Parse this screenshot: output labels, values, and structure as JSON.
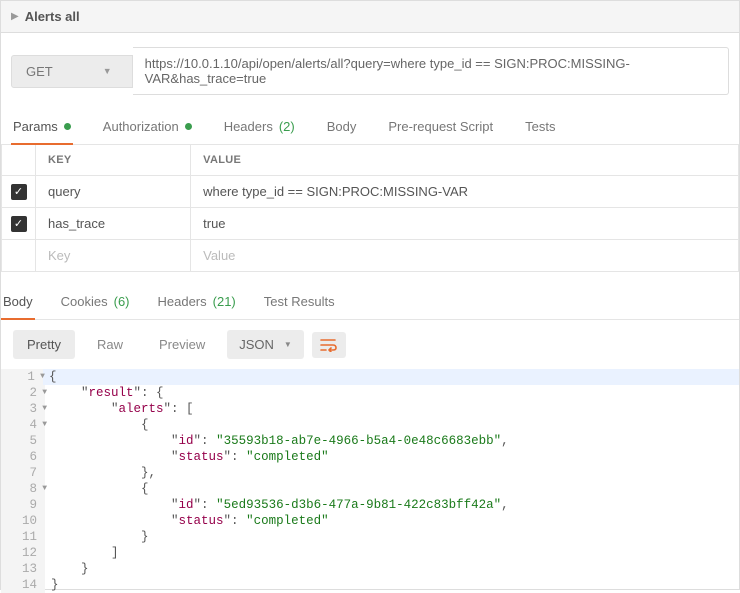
{
  "header": {
    "title": "Alerts all"
  },
  "request": {
    "method": "GET",
    "url": "https://10.0.1.10/api/open/alerts/all?query=where type_id == SIGN:PROC:MISSING-VAR&has_trace=true"
  },
  "req_tabs": {
    "params": "Params",
    "auth": "Authorization",
    "headers": "Headers",
    "headers_count": "(2)",
    "body": "Body",
    "prereq": "Pre-request Script",
    "tests": "Tests"
  },
  "params": {
    "header_key": "KEY",
    "header_value": "VALUE",
    "rows": [
      {
        "key": "query",
        "value": "where type_id == SIGN:PROC:MISSING-VAR"
      },
      {
        "key": "has_trace",
        "value": "true"
      }
    ],
    "placeholder_key": "Key",
    "placeholder_value": "Value"
  },
  "resp_tabs": {
    "body": "Body",
    "cookies": "Cookies",
    "cookies_count": "(6)",
    "headers": "Headers",
    "headers_count": "(21)",
    "tests": "Test Results"
  },
  "view_bar": {
    "pretty": "Pretty",
    "raw": "Raw",
    "preview": "Preview",
    "format": "JSON"
  },
  "json": {
    "l1": "{",
    "l2_a": "    \"",
    "l2_k": "result",
    "l2_b": "\": {",
    "l3_a": "        \"",
    "l3_k": "alerts",
    "l3_b": "\": [",
    "l4": "            {",
    "l5_a": "                \"",
    "l5_k": "id",
    "l5_b": "\": ",
    "l5_v": "\"35593b18-ab7e-4966-b5a4-0e48c6683ebb\"",
    "l5_c": ",",
    "l6_a": "                \"",
    "l6_k": "status",
    "l6_b": "\": ",
    "l6_v": "\"completed\"",
    "l7": "            },",
    "l8": "            {",
    "l9_a": "                \"",
    "l9_k": "id",
    "l9_b": "\": ",
    "l9_v": "\"5ed93536-d3b6-477a-9b81-422c83bff42a\"",
    "l9_c": ",",
    "l10_a": "                \"",
    "l10_k": "status",
    "l10_b": "\": ",
    "l10_v": "\"completed\"",
    "l11": "            }",
    "l12": "        ]",
    "l13": "    }",
    "l14": "}"
  },
  "lineno": {
    "n1": "1",
    "n2": "2",
    "n3": "3",
    "n4": "4",
    "n5": "5",
    "n6": "6",
    "n7": "7",
    "n8": "8",
    "n9": "9",
    "n10": "10",
    "n11": "11",
    "n12": "12",
    "n13": "13",
    "n14": "14"
  }
}
